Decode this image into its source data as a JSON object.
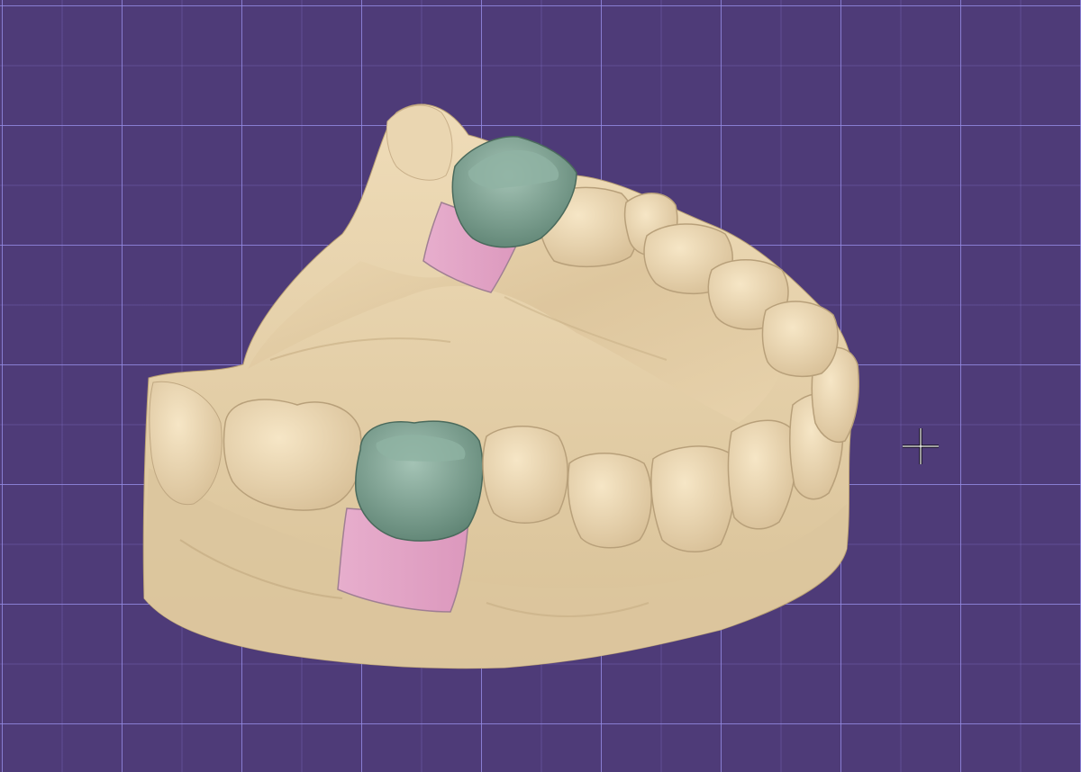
{
  "viewport": {
    "background_color": "#4e3b78",
    "grid_color": "#968ce6",
    "grid": true
  },
  "model": {
    "type": "dental-arch-scan",
    "base_color": "#e6d2ac",
    "crown_color": "#7fa393",
    "gingiva_color": "#e3a3c6",
    "crowns": [
      "upper-left-molar-crown",
      "lower-front-molar-crown"
    ]
  },
  "cursor": {
    "icon": "crosshair-icon"
  }
}
